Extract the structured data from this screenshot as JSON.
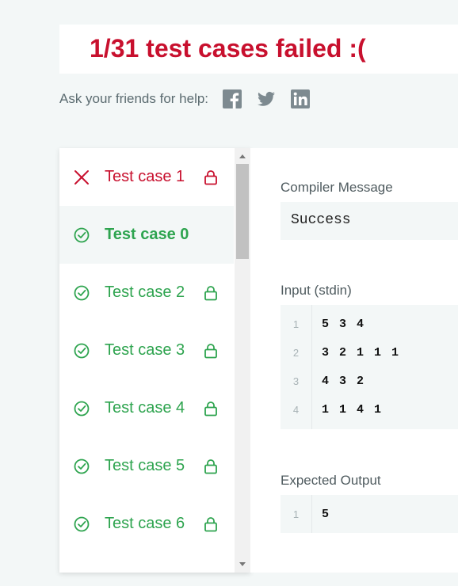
{
  "banner": {
    "title": "1/31 test cases failed :("
  },
  "share": {
    "label": "Ask your friends for help:",
    "icons": [
      "facebook-icon",
      "twitter-icon",
      "linkedin-icon"
    ]
  },
  "colors": {
    "fail": "#c8102e",
    "pass": "#2ea44f",
    "muted_bg": "#f3f7f7"
  },
  "test_cases": [
    {
      "label": "Test case 1",
      "status": "failed",
      "locked": true
    },
    {
      "label": "Test case 0",
      "status": "passed",
      "locked": false,
      "selected": true
    },
    {
      "label": "Test case 2",
      "status": "passed",
      "locked": true
    },
    {
      "label": "Test case 3",
      "status": "passed",
      "locked": true
    },
    {
      "label": "Test case 4",
      "status": "passed",
      "locked": true
    },
    {
      "label": "Test case 5",
      "status": "passed",
      "locked": true
    },
    {
      "label": "Test case 6",
      "status": "passed",
      "locked": true
    }
  ],
  "details": {
    "compiler_label": "Compiler Message",
    "compiler_message": "Success",
    "input_label": "Input (stdin)",
    "input_lines": [
      {
        "num": "1",
        "text": "5 3 4"
      },
      {
        "num": "2",
        "text": "3 2 1 1 1"
      },
      {
        "num": "3",
        "text": "4 3 2"
      },
      {
        "num": "4",
        "text": "1 1 4 1"
      }
    ],
    "expected_label": "Expected Output",
    "expected_lines": [
      {
        "num": "1",
        "text": "5"
      }
    ]
  }
}
